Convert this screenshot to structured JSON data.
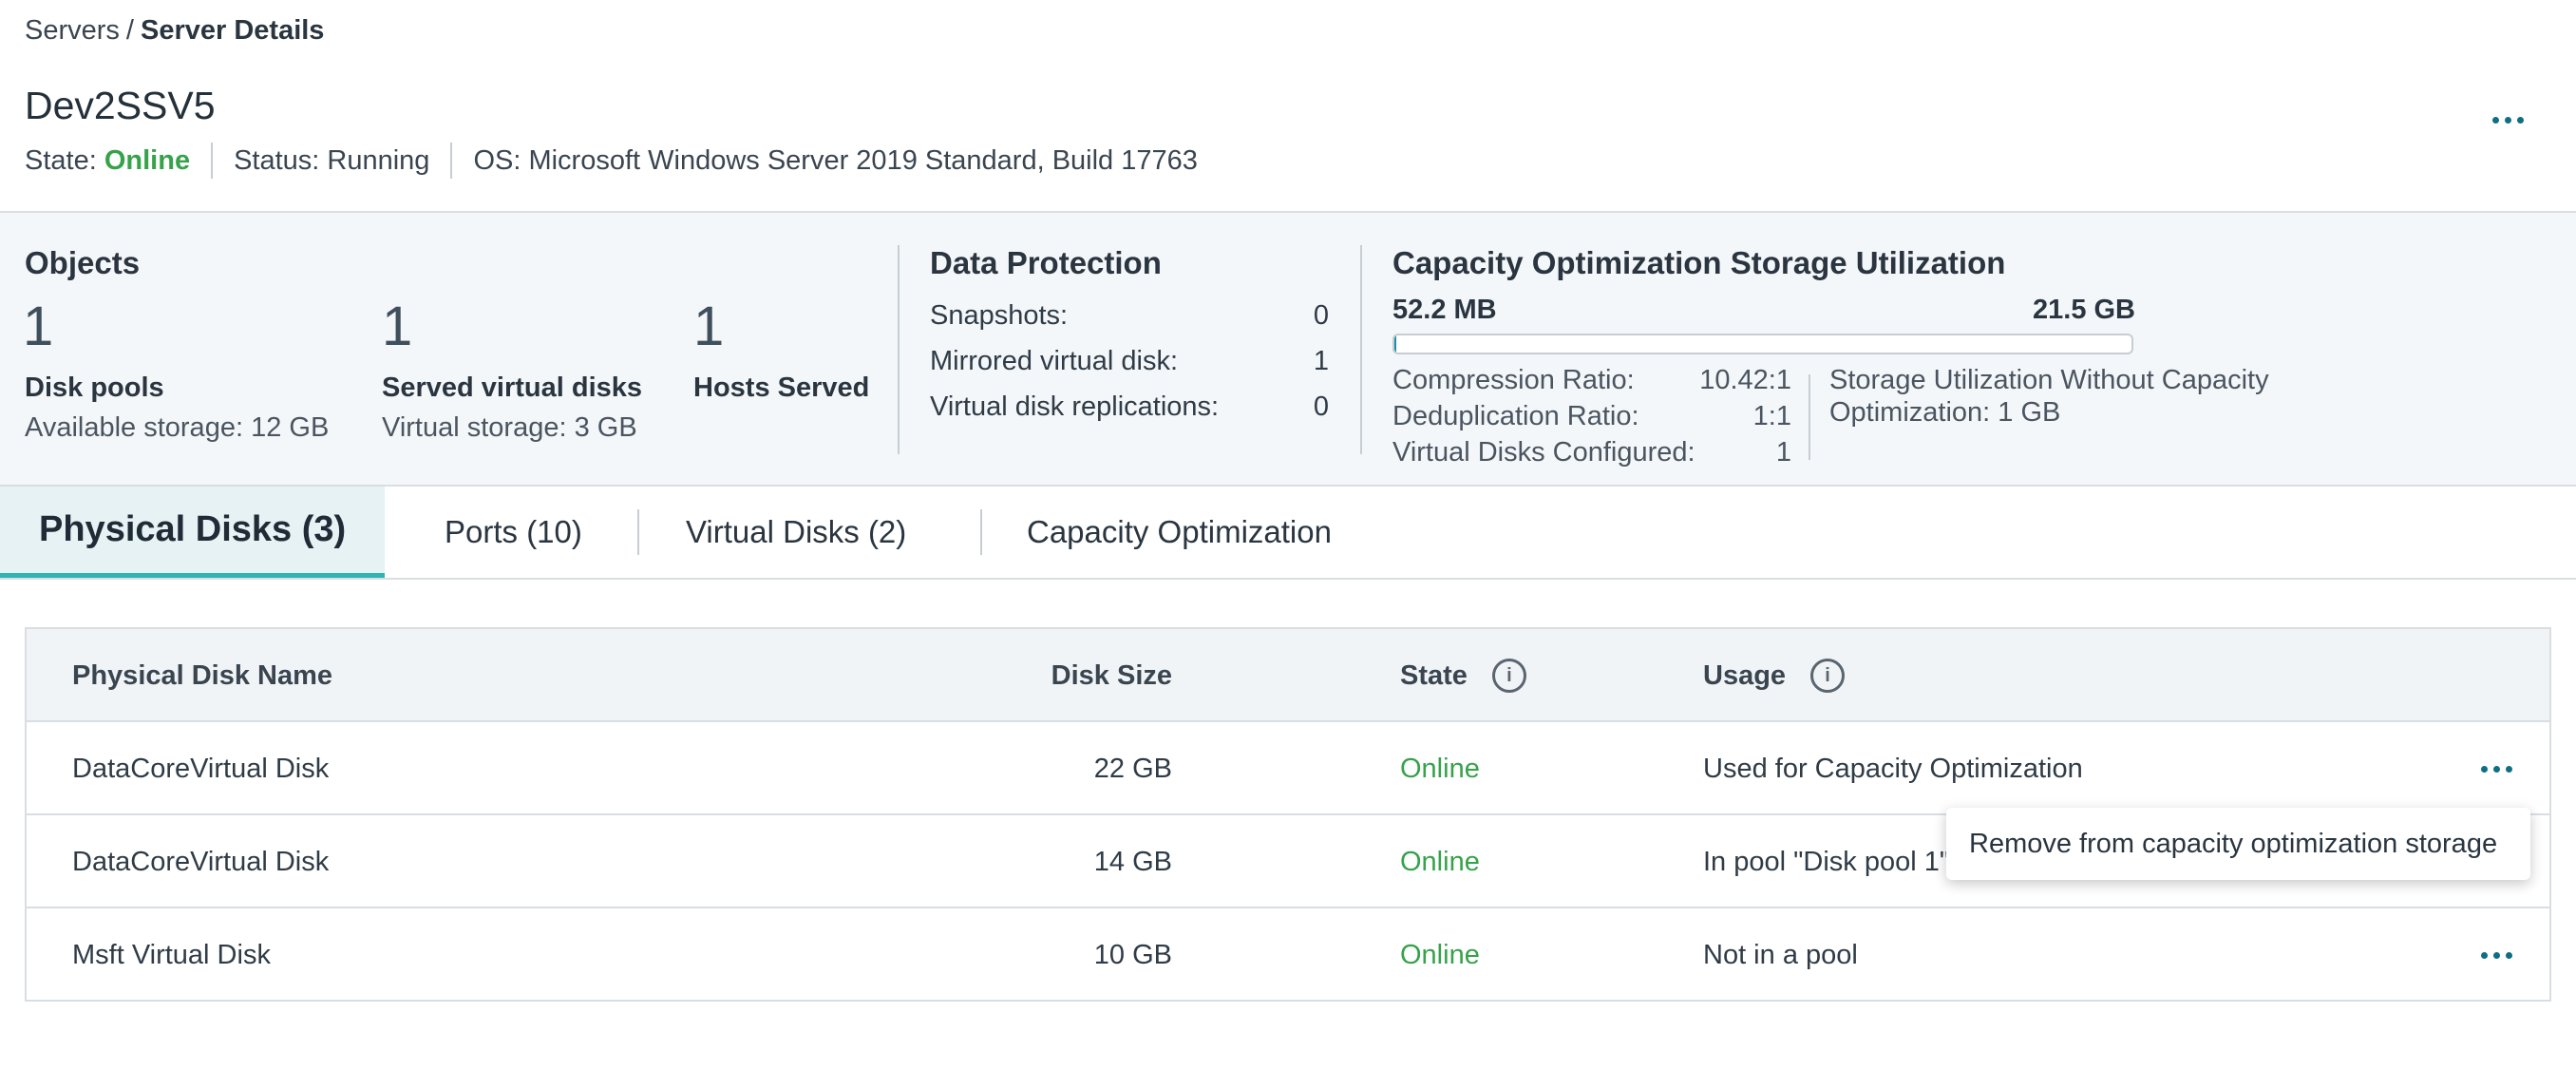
{
  "breadcrumb": {
    "parent": "Servers",
    "separator": "/",
    "current": "Server Details"
  },
  "server": {
    "name": "Dev2SSV5",
    "state_label": "State:",
    "state_value": "Online",
    "status": "Status: Running",
    "os": "OS: Microsoft Windows Server 2019 Standard, Build 17763"
  },
  "objects": {
    "title": "Objects",
    "disk_pools": {
      "count": "1",
      "label": "Disk pools",
      "sub_label": "Available storage:",
      "sub_value": "12 GB"
    },
    "served_virtual_disks": {
      "count": "1",
      "label": "Served virtual disks",
      "sub_label": "Virtual storage:",
      "sub_value": "3 GB"
    },
    "hosts_served": {
      "count": "1",
      "label": "Hosts Served"
    }
  },
  "data_protection": {
    "title": "Data Protection",
    "rows": [
      {
        "label": "Snapshots:",
        "value": "0"
      },
      {
        "label": "Mirrored virtual disk:",
        "value": "1"
      },
      {
        "label": "Virtual disk replications:",
        "value": "0"
      }
    ]
  },
  "capacity": {
    "title": "Capacity Optimization Storage Utilization",
    "used": "52.2 MB",
    "total": "21.5 GB",
    "used_fraction": 0.003,
    "rows": [
      {
        "label": "Compression Ratio:",
        "value": "10.42:1"
      },
      {
        "label": "Deduplication Ratio:",
        "value": "1:1"
      },
      {
        "label": "Virtual Disks Configured:",
        "value": "1"
      }
    ],
    "without_label_1": "Storage Utilization Without Capacity",
    "without_label_2": "Optimization:",
    "without_value": "1 GB"
  },
  "tabs": [
    {
      "label": "Physical Disks (3)"
    },
    {
      "label": "Ports (10)"
    },
    {
      "label": "Virtual Disks (2)"
    },
    {
      "label": "Capacity Optimization"
    }
  ],
  "table": {
    "columns": {
      "name": "Physical Disk Name",
      "size": "Disk Size",
      "state": "State",
      "usage": "Usage"
    },
    "rows": [
      {
        "name": "DataCoreVirtual Disk",
        "size": "22 GB",
        "state": "Online",
        "usage": "Used for Capacity Optimization"
      },
      {
        "name": "DataCoreVirtual Disk",
        "size": "14 GB",
        "state": "Online",
        "usage": "In pool \"Disk pool 1\""
      },
      {
        "name": "Msft Virtual Disk",
        "size": "10 GB",
        "state": "Online",
        "usage": "Not in a pool"
      }
    ]
  },
  "popup": {
    "label": "Remove from capacity optimization storage"
  },
  "colors": {
    "accent": "#0e6e84",
    "online": "#36a24a",
    "tab_active_bg": "#e6f2f3",
    "tab_underline": "#2fb3b3"
  },
  "icons": {
    "more": "more-horizontal-icon",
    "info": "info-icon"
  }
}
